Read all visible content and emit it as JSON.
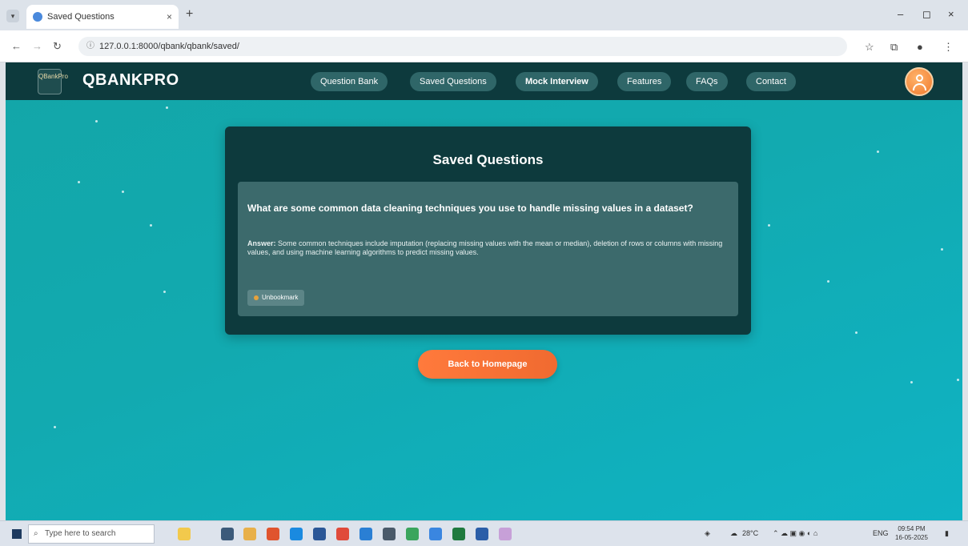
{
  "browser": {
    "tab_title": "Saved Questions",
    "tab_close": "×",
    "new_tab": "+",
    "url": "127.0.0.1:8000/qbank/qbank/saved/",
    "window_controls": [
      "–",
      "◻",
      "×"
    ]
  },
  "navbar": {
    "brand": "QBANKPRO",
    "logo_text": "QBankPro",
    "links": [
      {
        "label": "Question Bank"
      },
      {
        "label": "Saved Questions"
      },
      {
        "label": "Mock Interview"
      },
      {
        "label": "Features"
      },
      {
        "label": "FAQs"
      },
      {
        "label": "Contact"
      }
    ]
  },
  "card": {
    "title": "Saved Questions",
    "question": "What are some common data cleaning techniques you use to handle missing values in a dataset?",
    "answer_label": "Answer:",
    "answer_text": "Some common techniques include imputation (replacing missing values with the mean or median), deletion of rows or columns with missing values, and using machine learning algorithms to predict missing values.",
    "unbookmark_label": "Unbookmark"
  },
  "back_button": "Back to Homepage",
  "taskbar": {
    "search_placeholder": "Type here to search",
    "weather": "28°C",
    "lang": "ENG",
    "time": "09:54 PM",
    "date": "16-05-2025"
  },
  "colors": {
    "navbar": "#0d3a3d",
    "accent_orange": "#f06a30",
    "page_teal": "#12aab0"
  }
}
